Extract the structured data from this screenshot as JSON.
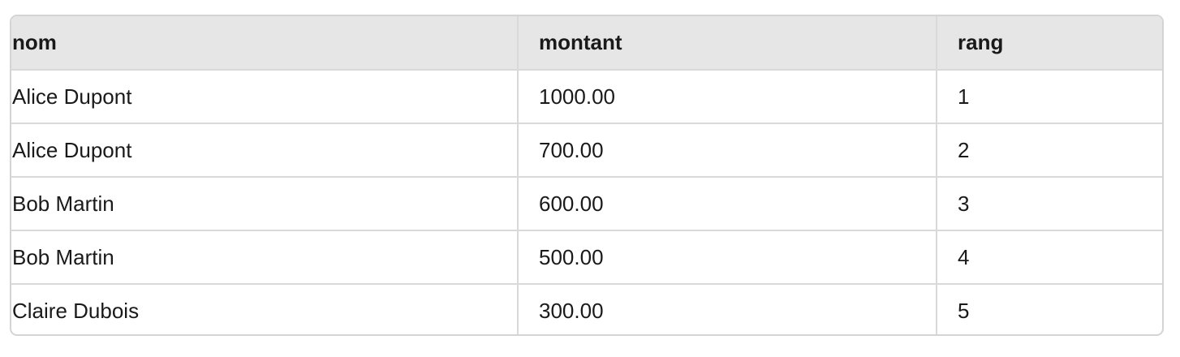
{
  "table": {
    "headers": [
      "nom",
      "montant",
      "rang"
    ],
    "rows": [
      [
        "Alice Dupont",
        "1000.00",
        "1"
      ],
      [
        "Alice Dupont",
        "700.00",
        "2"
      ],
      [
        "Bob Martin",
        "600.00",
        "3"
      ],
      [
        "Bob Martin",
        "500.00",
        "4"
      ],
      [
        "Claire Dubois",
        "300.00",
        "5"
      ]
    ]
  },
  "colors": {
    "header_bg": "#e6e6e6",
    "border": "#d4d4d4",
    "text": "#1a1a1a"
  }
}
